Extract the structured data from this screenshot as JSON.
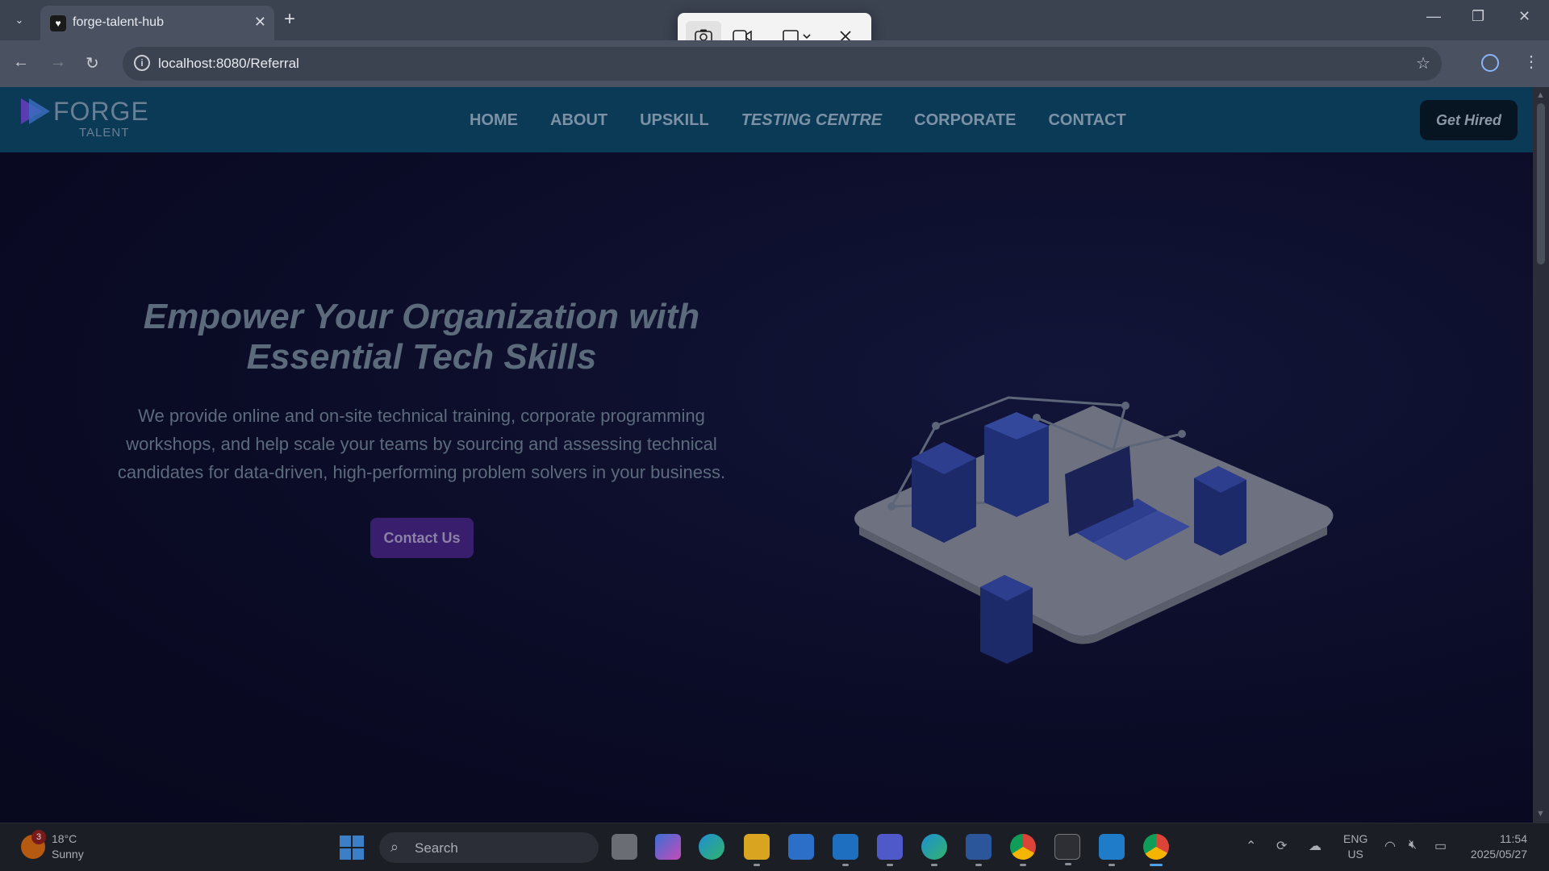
{
  "browser": {
    "tab_title": "forge-talent-hub",
    "tab_close": "✕",
    "new_tab": "+",
    "url": "localhost:8080/Referral",
    "win_minimize": "—",
    "win_restore": "❐",
    "win_close": "✕"
  },
  "header": {
    "logo_word": "FORGE",
    "logo_sub": "TALENT",
    "nav": [
      "HOME",
      "ABOUT",
      "UPSKILL",
      "TESTING CENTRE",
      "CORPORATE",
      "CONTACT"
    ],
    "cta": "Get Hired"
  },
  "hero": {
    "title": "Empower Your Organization with Essential Tech Skills",
    "text": "We provide online and on-site technical training, corporate programming workshops, and help scale your teams by sourcing and assessing technical candidates for data-driven, high-performing problem solvers in your business.",
    "button": "Contact Us"
  },
  "taskbar": {
    "weather_badge": "3",
    "temperature": "18°C",
    "condition": "Sunny",
    "search_placeholder": "Search",
    "lang_top": "ENG",
    "lang_bottom": "US",
    "time": "11:54",
    "date": "2025/05/27"
  },
  "colors": {
    "header_bg": "#0a3a55",
    "page_bg": "#0a0b25",
    "contact_button": "#391e6e",
    "chat_fab": "#7a1d3c"
  }
}
